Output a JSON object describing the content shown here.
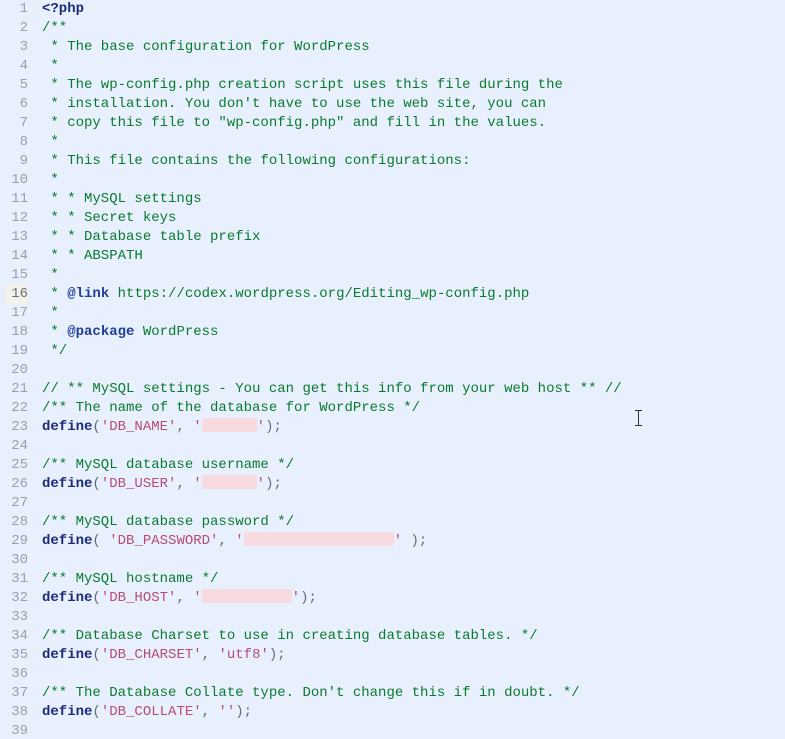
{
  "editor": {
    "current_line": 16,
    "total_lines": 39
  },
  "code": {
    "php_open": "<?php",
    "doc_open": "/**",
    "doc_1": " * The base configuration for WordPress",
    "doc_star": " *",
    "doc_2": " * The wp-config.php creation script uses this file during the",
    "doc_3": " * installation. You don't have to use the web site, you can",
    "doc_4": " * copy this file to \"wp-config.php\" and fill in the values.",
    "doc_5": " * This file contains the following configurations:",
    "doc_6": " * * MySQL settings",
    "doc_7": " * * Secret keys",
    "doc_8": " * * Database table prefix",
    "doc_9": " * * ABSPATH",
    "link_kw": "@link",
    "link_url": " https://codex.wordpress.org/Editing_wp-config.php",
    "link_prefix": " * ",
    "pkg_kw": "@package",
    "pkg_name": " WordPress",
    "pkg_prefix": " * ",
    "doc_close": " */",
    "mysql_banner": "// ** MySQL settings - You can get this info from your web host ** //",
    "dbname_com": "/** The name of the database for WordPress */",
    "define": "define",
    "open_paren": "(",
    "open_paren_sp": "( ",
    "close_paren": ");",
    "close_paren_sp": " );",
    "dbname_key": "'DB_NAME'",
    "dbuser_com": "/** MySQL database username */",
    "dbuser_key": "'DB_USER'",
    "dbpass_com": "/** MySQL database password */",
    "dbpass_key": "'DB_PASSWORD'",
    "dbhost_com": "/** MySQL hostname */",
    "dbhost_key": "'DB_HOST'",
    "charset_com": "/** Database Charset to use in creating database tables. */",
    "charset_key": "'DB_CHARSET'",
    "charset_val": "'utf8'",
    "collate_com": "/** The Database Collate type. Don't change this if in doubt. */",
    "collate_key": "'DB_COLLATE'",
    "collate_val": "''",
    "sep": ", ",
    "quote": "'",
    "redact": {
      "db_name_w": 55,
      "db_user_w": 55,
      "db_pass_w": 150,
      "db_host_w": 90
    }
  },
  "chart_data": null
}
